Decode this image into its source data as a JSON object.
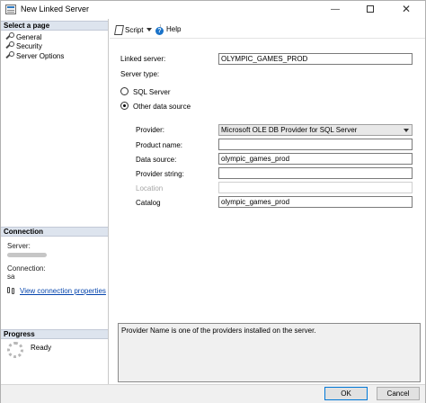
{
  "window": {
    "title": "New Linked Server"
  },
  "titlebar": {
    "minimize": "—",
    "close": "✕"
  },
  "left_panel": {
    "select_page_header": "Select a page",
    "pages": [
      "General",
      "Security",
      "Server Options"
    ],
    "connection_header": "Connection",
    "server_label": "Server:",
    "connection_label": "Connection:",
    "connection_value": "sa",
    "view_connection_properties": "View connection properties",
    "progress_header": "Progress",
    "progress_status": "Ready"
  },
  "toolbar": {
    "script_label": "Script",
    "help_label": "Help"
  },
  "general": {
    "linked_server_label": "Linked server:",
    "linked_server_value": "OLYMPIC_GAMES_PROD",
    "server_type_label": "Server type:",
    "sql_server_option": "SQL Server",
    "other_data_source_option": "Other data source",
    "selected_server_type": "Other data source",
    "provider_label": "Provider:",
    "provider_value": "Microsoft OLE DB Provider for SQL Server",
    "product_name_label": "Product name:",
    "product_name_value": "",
    "data_source_label": "Data source:",
    "data_source_value": "olympic_games_prod",
    "provider_string_label": "Provider string:",
    "provider_string_value": "",
    "location_label": "Location",
    "location_value": "",
    "catalog_label": "Catalog",
    "catalog_value": "olympic_games_prod",
    "description_text": "Provider Name is one of the providers installed on the server."
  },
  "buttons": {
    "ok": "OK",
    "cancel": "Cancel"
  }
}
